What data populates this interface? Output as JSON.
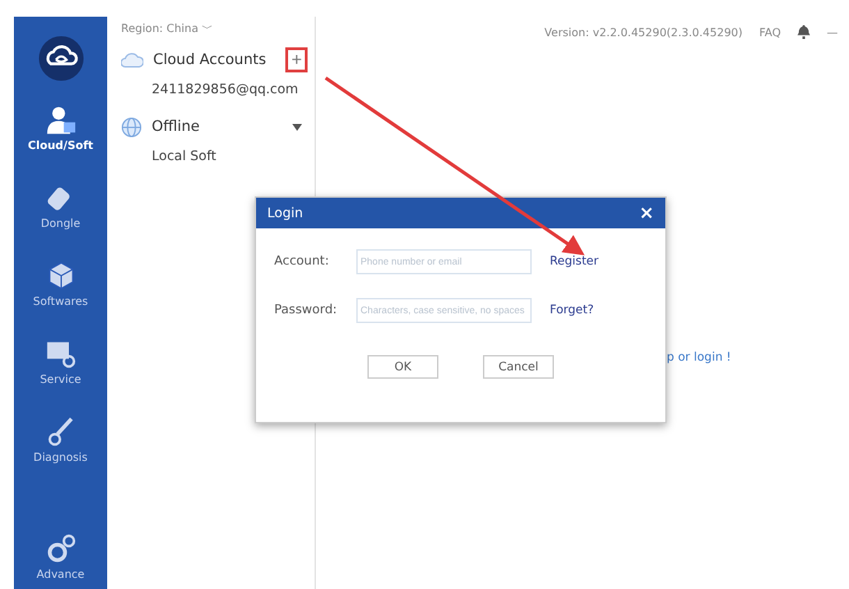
{
  "header": {
    "region": "Region: China ﹀",
    "version": "Version: v2.2.0.45290(2.3.0.45290)",
    "faq": "FAQ",
    "minimize": "—"
  },
  "sidebar": {
    "items": [
      {
        "label": "Cloud/Soft",
        "kind": "user",
        "selected": true
      },
      {
        "label": "Dongle",
        "kind": "dongle",
        "selected": false
      },
      {
        "label": "Softwares",
        "kind": "cube",
        "selected": false
      },
      {
        "label": "Service",
        "kind": "service",
        "selected": false
      },
      {
        "label": "Diagnosis",
        "kind": "diagnosis",
        "selected": false
      },
      {
        "label": "Advance",
        "kind": "gears",
        "selected": false
      }
    ]
  },
  "accounts": {
    "groups": [
      {
        "label": "Cloud Accounts",
        "kind": "cloud",
        "add": "+",
        "children": [
          {
            "label": "2411829856@qq.com"
          }
        ]
      },
      {
        "label": "Offline",
        "kind": "globe",
        "expanded": true,
        "children": [
          {
            "label": "Local Soft"
          }
        ]
      }
    ]
  },
  "main": {
    "hint": "p or login !"
  },
  "dialog": {
    "title": "Login",
    "close": "×",
    "fields": [
      {
        "label": "Account:",
        "placeholder": "Phone number or email",
        "link": "Register"
      },
      {
        "label": "Password:",
        "placeholder": "Characters, case sensitive, no spaces",
        "link": "Forget?"
      }
    ],
    "buttons": [
      "OK",
      "Cancel"
    ]
  }
}
